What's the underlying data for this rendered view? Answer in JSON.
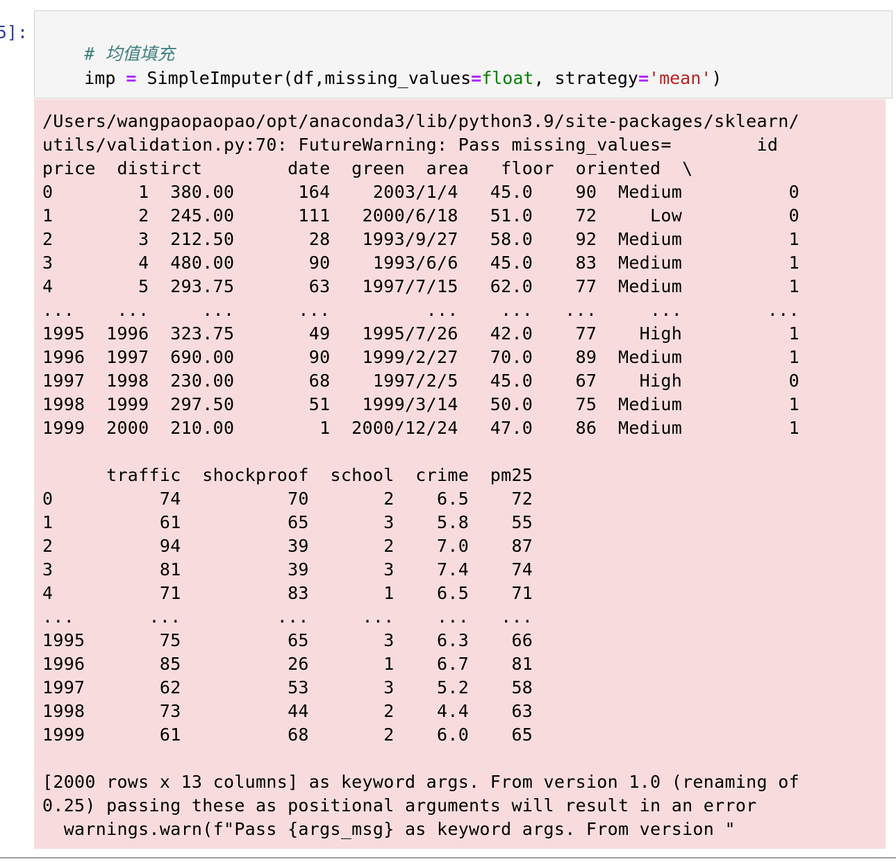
{
  "cell": {
    "prompt": "5]:",
    "code": {
      "comment": "# 均值填充",
      "line2_parts": [
        "imp",
        " = ",
        "SimpleImputer(df,missing_values",
        "=",
        "float",
        ", strategy",
        "=",
        "'mean'",
        ")"
      ]
    }
  },
  "output": {
    "lines": [
      "/Users/wangpaopaopao/opt/anaconda3/lib/python3.9/site-packages/sklearn/",
      "utils/validation.py:70: FutureWarning: Pass missing_values=        id",
      "price  distirct        date  green  area   floor  oriented  \\",
      "0        1  380.00      164    2003/1/4   45.0    90  Medium          0",
      "1        2  245.00      111   2000/6/18   51.0    72     Low          0",
      "2        3  212.50       28   1993/9/27   58.0    92  Medium          1",
      "3        4  480.00       90    1993/6/6   45.0    83  Medium          1",
      "4        5  293.75       63   1997/7/15   62.0    77  Medium          1",
      "...    ...     ...      ...         ...    ...   ...     ...        ...",
      "1995  1996  323.75       49   1995/7/26   42.0    77    High          1",
      "1996  1997  690.00       90   1999/2/27   70.0    89  Medium          1",
      "1997  1998  230.00       68    1997/2/5   45.0    67    High          0",
      "1998  1999  297.50       51   1999/3/14   50.0    75  Medium          1",
      "1999  2000  210.00        1  2000/12/24   47.0    86  Medium          1",
      "",
      "      traffic  shockproof  school  crime  pm25",
      "0          74          70       2    6.5    72",
      "1          61          65       3    5.8    55",
      "2          94          39       2    7.0    87",
      "3          81          39       3    7.4    74",
      "4          71          83       1    6.5    71",
      "...       ...         ...     ...    ...   ...",
      "1995       75          65       3    6.3    66",
      "1996       85          26       1    6.7    81",
      "1997       62          53       3    5.2    58",
      "1998       73          44       2    4.4    63",
      "1999       61          68       2    6.0    65",
      "",
      "[2000 rows x 13 columns] as keyword args. From version 1.0 (renaming of",
      "0.25) passing these as positional arguments will result in an error",
      "  warnings.warn(f\"Pass {args_msg} as keyword args. From version \""
    ]
  },
  "colors": {
    "output_background": "#f8dcdd",
    "code_background": "#f5f5f5",
    "prompt": "#303f9f",
    "comment": "#408080",
    "operator": "#aa22ff",
    "builtin": "#008000",
    "string": "#ba2121"
  }
}
